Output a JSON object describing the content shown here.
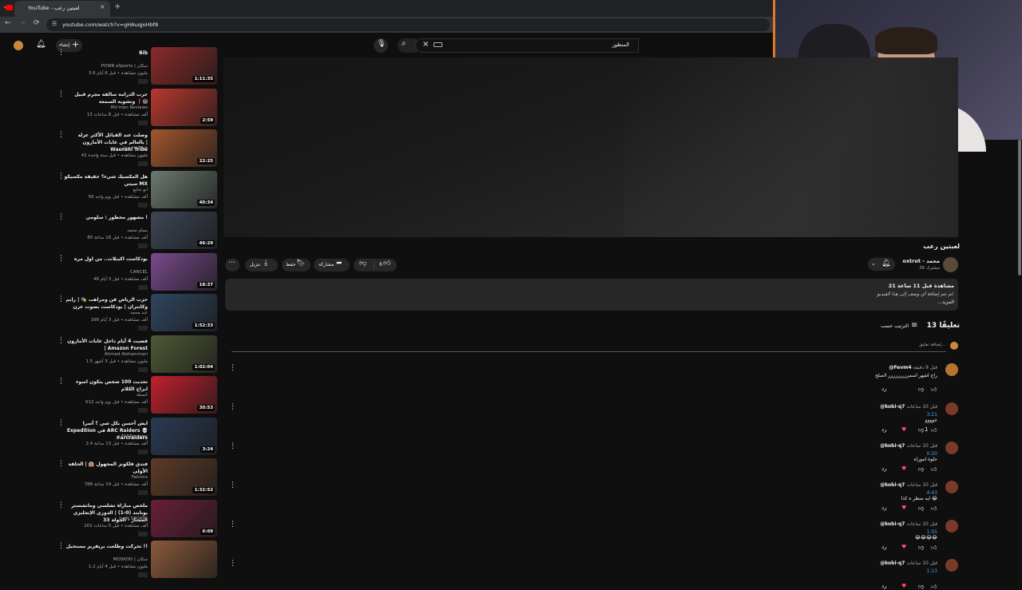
{
  "browser": {
    "tab_title": "YouTube - لعبتين رعب",
    "tab_close": "×",
    "new_tab": "+",
    "tab_menu": "⌄",
    "url": "youtube.com/watch?v=gHAuqjoHbf8"
  },
  "header": {
    "search_query": "المنظور",
    "create_label": "إنشاء",
    "icons": {
      "search": "search-icon",
      "mic": "mic-icon",
      "bell": "bell-icon",
      "create": "plus-icon"
    }
  },
  "video": {
    "title": "لعبتين رعب",
    "channel_name": "oxtrot - محمد",
    "channel_subs": "36 مشترك",
    "like_count": "6",
    "share_label": "مشاركة",
    "save_label": "حفظ",
    "download_label": "تنزيل"
  },
  "description": {
    "stats": "21 مشاهدة قبل 11 ساعة",
    "text": "لم تتم إضافة أي وصف إلى هذا الفيديو.",
    "more": "...المزيد"
  },
  "comments": {
    "count_label": "13 تعليقًا",
    "sort_label": "الترتيب حسب",
    "add_placeholder": "إضافة تعليق...",
    "reply_label": "رد",
    "items": [
      {
        "author": "@Fevm4",
        "time": "قبل 9 دقيقة",
        "text": "راح اشهر اسمررررررررر لاصلح",
        "timestamp": "",
        "likes": "",
        "heart": false
      },
      {
        "author": "@kobi-q7",
        "time": "قبل 10 ساعات",
        "text": "خوووو",
        "timestamp": "3:21",
        "likes": "1",
        "heart": true
      },
      {
        "author": "@kobi-q7",
        "time": "قبل 10 ساعات",
        "text": "حلوة اموراه",
        "timestamp": "0:20",
        "likes": "",
        "heart": true
      },
      {
        "author": "@kobi-q7",
        "time": "قبل 10 ساعات",
        "text": "ايه منظر ه كذا 😂",
        "timestamp": "4:43",
        "likes": "",
        "heart": true
      },
      {
        "author": "@kobi-q7",
        "time": "قبل 10 ساعات",
        "text": "😂😂😂😂",
        "timestamp": "1:55",
        "likes": "",
        "heart": true
      },
      {
        "author": "@kobi-q7",
        "time": "قبل 10 ساعات",
        "text": "",
        "timestamp": "1:13",
        "likes": "",
        "heart": true
      }
    ]
  },
  "sidebar": {
    "items": [
      {
        "title": "Bib",
        "channel": "POWR eSports | سكان",
        "meta": "3.6 مليون مشاهدة • قبل 6 أيام",
        "duration": "1:11:35",
        "color": "#8a2a2a"
      },
      {
        "title": "حرب الدرامة سالفة مجرم قبيل وتشويه السمعة ❗😱",
        "channel": "Mo'men Reviews",
        "meta": "13 ألف مشاهدة • قبل 8 ساعات",
        "duration": "2:59",
        "color": "#b8392f"
      },
      {
        "title": "وصلت عند القبائل الأكثر عزلة بالعالم في غابات الأمازون | Waorani Tribe",
        "channel": "Joe HaTTab",
        "meta": "41 مليون مشاهدة • قبل سنة واحدة",
        "duration": "22:25",
        "color": "#a3562c"
      },
      {
        "title": "هل المكسيك شيء؟ حقيقة مكسيكو سيتي MX",
        "channel": "ابو شايع",
        "meta": "56 ألف مشاهدة • قبل يوم واحد",
        "duration": "40:34",
        "color": "#6c7a70"
      },
      {
        "title": "مشهور محظور : سلومي !",
        "channel": "بسام محمد",
        "meta": "80 ألف مشاهدة • قبل 16 ساعة",
        "duration": "46:29",
        "color": "#3d4655"
      },
      {
        "title": "بودكاست اكيبلات.. من اول مره",
        "channel": "CANCEL",
        "meta": "46 ألف مشاهدة • قبل 3 أيام",
        "duration": "18:37",
        "color": "#7a4a8c"
      },
      {
        "title": "حزب الرياض فن ومراهب 🎭 | رايم وكابتران | بودكاست بصوت عرن",
        "channel": "عبد محمد",
        "meta": "168 ألف مشاهدة • قبل 3 أيام",
        "duration": "1:52:33",
        "color": "#2f4660"
      },
      {
        "title": "قضيت 4 أيام داخل غابات الأمازون | Amazon Forest",
        "channel": "Ahmed Alshammari",
        "meta": "1.5 مليون مشاهدة • قبل 3 أشهر",
        "duration": "1:02:04",
        "color": "#4f5a36"
      },
      {
        "title": "تحديت 100 شخص يتكون اسوء ابراج الكلام",
        "channel": "كنسلة",
        "meta": "512 ألف مشاهدة • قبل يوم واحد",
        "duration": "30:53",
        "color": "#c2202c"
      },
      {
        "title": "ايش أحسن بكل شي ؟ أسرا Expedition في ARC Raiders 💀 #arcraiders",
        "channel": "TANReviews",
        "meta": "2.4 ألف مشاهدة • قبل 13 ساعة",
        "duration": "3:24",
        "color": "#2a3b55"
      },
      {
        "title": "فندق فلكونز المجهول 🏨 | الحلقة الأولى",
        "channel": "Falcons",
        "meta": "788 ألف مشاهدة • قبل 14 ساعة",
        "duration": "1:32:52",
        "color": "#5e3b26"
      },
      {
        "title": "ملخص مباراة تشلسي ومانشستر يونايتد (0-1) | الدوري الإنجليزي الممتاز - الجولة 33",
        "channel": "beIN SPORTS",
        "meta": "201 ألف مشاهدة • قبل 5 ساعات",
        "duration": "6:09",
        "color": "#6a1f3a"
      },
      {
        "title": "تحركت وطلعت بريفريز مستحيل !!",
        "channel": "MOSKOO | سكان",
        "meta": "1.2 مليون مشاهدة • قبل 4 أيام",
        "duration": "",
        "color": "#8c5a3a"
      }
    ]
  }
}
